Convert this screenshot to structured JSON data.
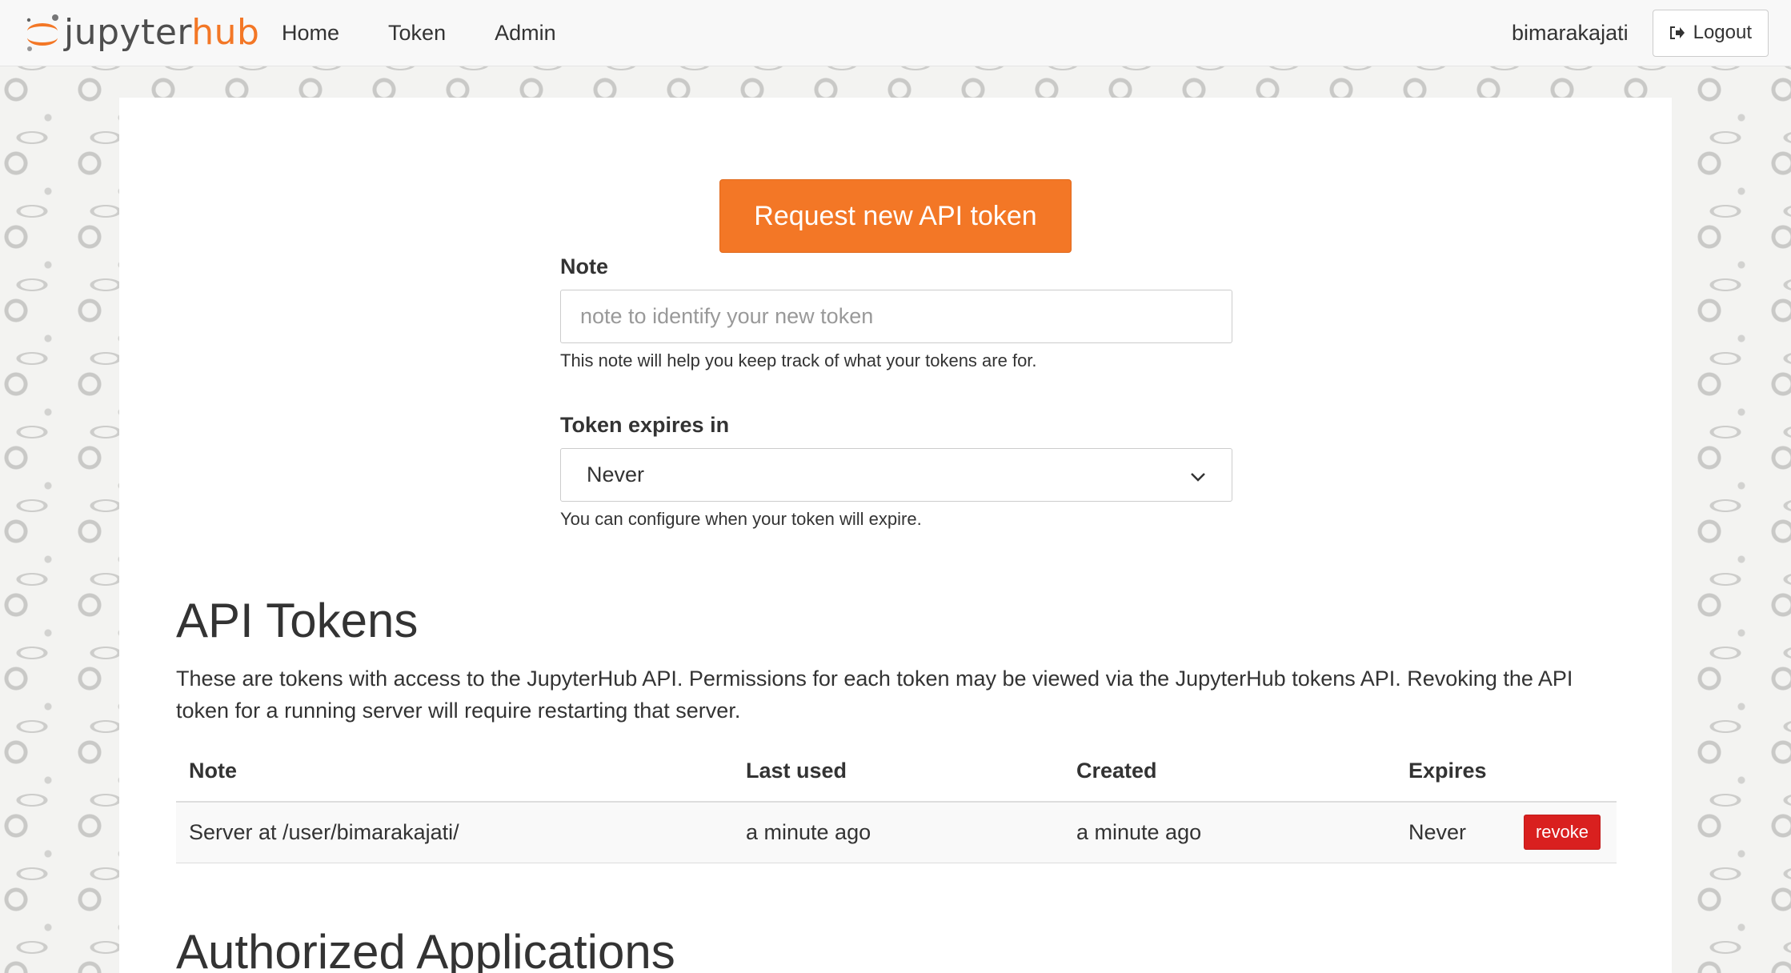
{
  "navbar": {
    "brand": {
      "part1": "jupyter",
      "part2": "hub"
    },
    "links": [
      "Home",
      "Token",
      "Admin"
    ],
    "username": "bimarakajati",
    "logout_label": "Logout"
  },
  "token_form": {
    "request_button": "Request new API token",
    "note_label": "Note",
    "note_placeholder": "note to identify your new token",
    "note_help": "This note will help you keep track of what your tokens are for.",
    "expires_label": "Token expires in",
    "expires_selected": "Never",
    "expires_help": "You can configure when your token will expire."
  },
  "api_tokens": {
    "title": "API Tokens",
    "description": "These are tokens with access to the JupyterHub API. Permissions for each token may be viewed via the JupyterHub tokens API. Revoking the API token for a running server will require restarting that server.",
    "columns": [
      "Note",
      "Last used",
      "Created",
      "Expires"
    ],
    "rows": [
      {
        "note": "Server at /user/bimarakajati/",
        "last_used": "a minute ago",
        "created": "a minute ago",
        "expires": "Never",
        "action": "revoke"
      }
    ]
  },
  "authorized_apps": {
    "title": "Authorized Applications"
  },
  "colors": {
    "brand_orange": "#f37726",
    "revoke_red": "#d9201f",
    "text": "#333333"
  }
}
